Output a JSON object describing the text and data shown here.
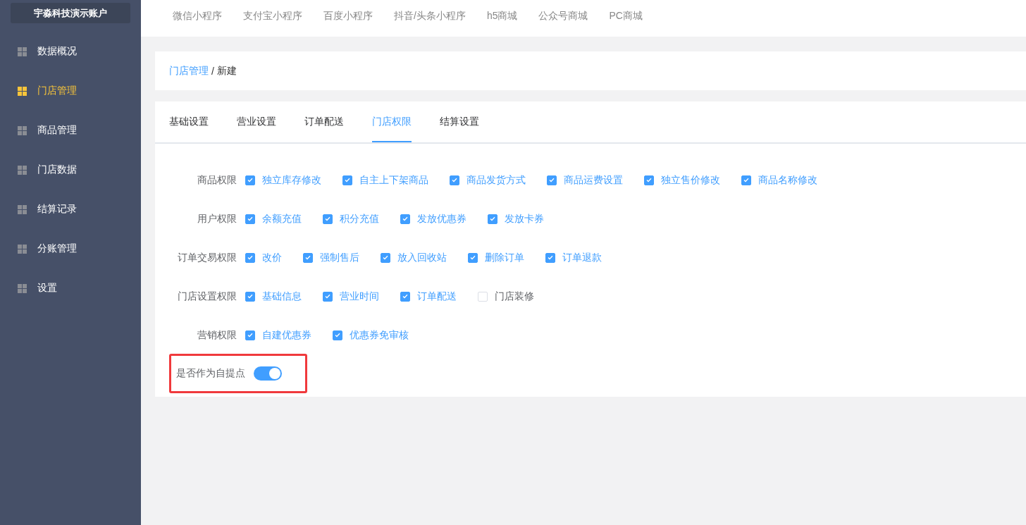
{
  "sidebar": {
    "account": "宇淼科技演示账户",
    "items": [
      {
        "label": "数据概况",
        "selected": false
      },
      {
        "label": "门店管理",
        "selected": true
      },
      {
        "label": "商品管理",
        "selected": false
      },
      {
        "label": "门店数据",
        "selected": false
      },
      {
        "label": "结算记录",
        "selected": false
      },
      {
        "label": "分账管理",
        "selected": false
      },
      {
        "label": "设置",
        "selected": false
      }
    ]
  },
  "top_nav": {
    "items": [
      "微信小程序",
      "支付宝小程序",
      "百度小程序",
      "抖音/头条小程序",
      "h5商城",
      "公众号商城",
      "PC商城"
    ]
  },
  "breadcrumb": {
    "link": "门店管理",
    "separator": "/",
    "current": "新建"
  },
  "tabs": [
    {
      "label": "基础设置",
      "selected": false
    },
    {
      "label": "营业设置",
      "selected": false
    },
    {
      "label": "订单配送",
      "selected": false
    },
    {
      "label": "门店权限",
      "selected": true
    },
    {
      "label": "结算设置",
      "selected": false
    }
  ],
  "permissions": [
    {
      "label": "商品权限",
      "options": [
        {
          "label": "独立库存修改",
          "checked": true
        },
        {
          "label": "自主上下架商品",
          "checked": true
        },
        {
          "label": "商品发货方式",
          "checked": true
        },
        {
          "label": "商品运费设置",
          "checked": true
        },
        {
          "label": "独立售价修改",
          "checked": true
        },
        {
          "label": "商品名称修改",
          "checked": true
        }
      ]
    },
    {
      "label": "用户权限",
      "options": [
        {
          "label": "余额充值",
          "checked": true
        },
        {
          "label": "积分充值",
          "checked": true
        },
        {
          "label": "发放优惠券",
          "checked": true
        },
        {
          "label": "发放卡券",
          "checked": true
        }
      ]
    },
    {
      "label": "订单交易权限",
      "options": [
        {
          "label": "改价",
          "checked": true
        },
        {
          "label": "强制售后",
          "checked": true
        },
        {
          "label": "放入回收站",
          "checked": true
        },
        {
          "label": "删除订单",
          "checked": true
        },
        {
          "label": "订单退款",
          "checked": true
        }
      ]
    },
    {
      "label": "门店设置权限",
      "options": [
        {
          "label": "基础信息",
          "checked": true
        },
        {
          "label": "营业时间",
          "checked": true
        },
        {
          "label": "订单配送",
          "checked": true
        },
        {
          "label": "门店装修",
          "checked": false
        }
      ]
    },
    {
      "label": "营销权限",
      "options": [
        {
          "label": "自建优惠券",
          "checked": true
        },
        {
          "label": "优惠券免审核",
          "checked": true
        }
      ]
    }
  ],
  "pickup_toggle": {
    "label": "是否作为自提点",
    "on": true,
    "highlighted": true
  }
}
